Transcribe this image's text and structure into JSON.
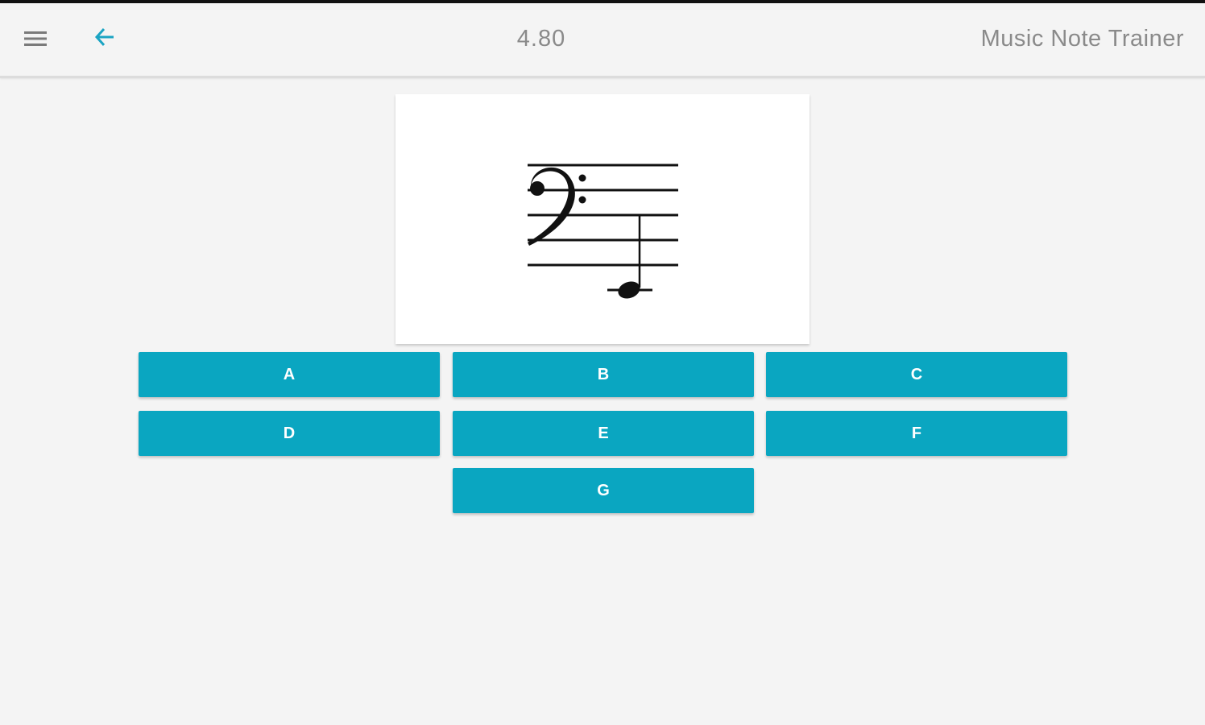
{
  "toolbar": {
    "menu_icon": "hamburger-menu-icon",
    "back_icon": "arrow-left-icon",
    "score": "4.80",
    "title": "Music Note Trainer"
  },
  "staff": {
    "clef": "bass-clef",
    "note": "quarter-note"
  },
  "answers": [
    {
      "label": "A"
    },
    {
      "label": "B"
    },
    {
      "label": "C"
    },
    {
      "label": "D"
    },
    {
      "label": "E"
    },
    {
      "label": "F"
    },
    {
      "label": "G"
    }
  ],
  "colors": {
    "accent": "#0aa6c1",
    "background": "#f4f4f4",
    "muted_text": "#8a8a8a"
  }
}
